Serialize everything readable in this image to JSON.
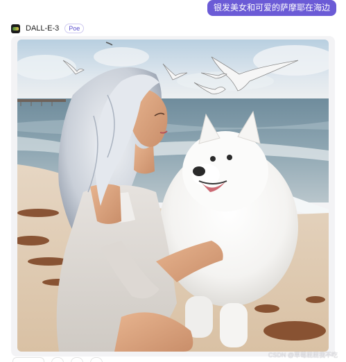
{
  "user_message": {
    "text": "银发美女和可爱的萨摩耶在海边"
  },
  "bot": {
    "name": "DALL-E-3",
    "badge": "Poe",
    "icon": "dalle-logo-icon"
  },
  "generated_image": {
    "alt": "银发美女和可爱的萨摩耶在海边"
  },
  "watermark": {
    "text": "CSDN @草莓屁屁我不吃"
  },
  "colors": {
    "user_bubble": "#6b5bd6",
    "badge": "#5b4fcf",
    "card_background": "#f3f3f5"
  }
}
